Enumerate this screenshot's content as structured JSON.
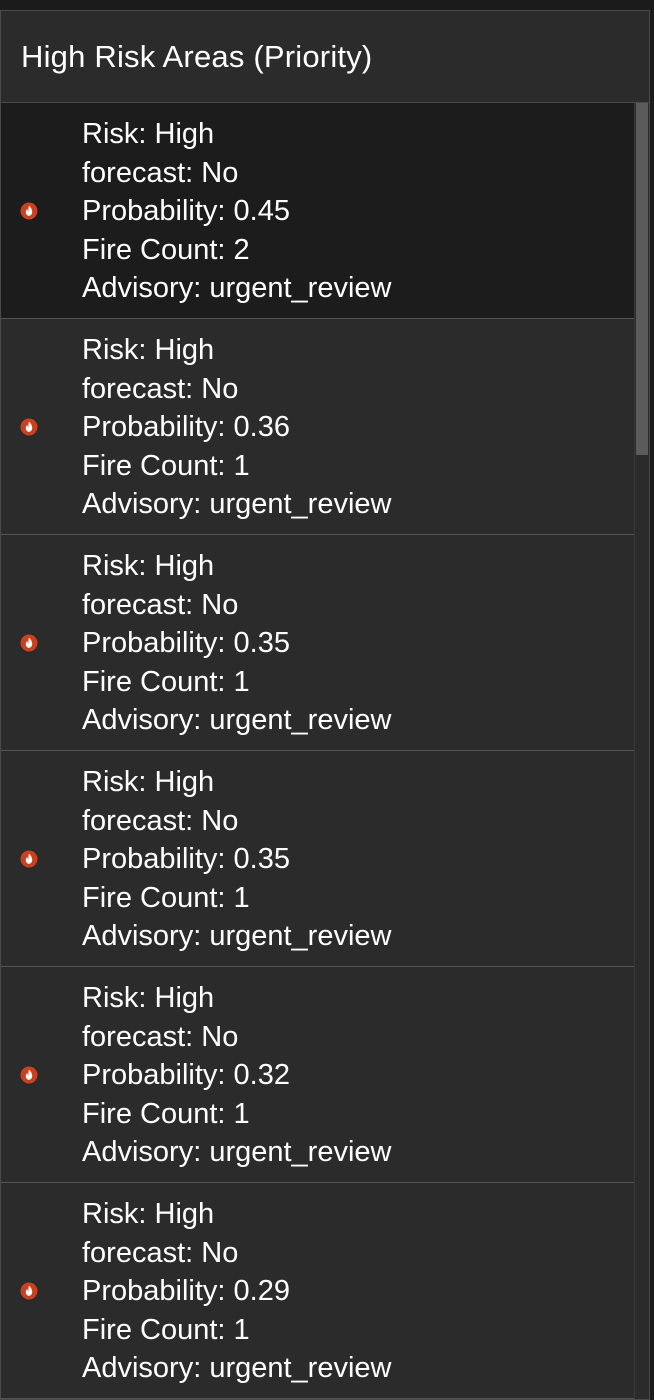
{
  "panel": {
    "title": "High Risk Areas (Priority)"
  },
  "icon": "fire-icon",
  "colors": {
    "icon_fill": "#c8421f",
    "icon_flame": "#ffffff"
  },
  "items": [
    {
      "risk": "Risk: High",
      "forecast": "forecast: No",
      "probability": "Probability: 0.45",
      "fire_count": "Fire Count: 2",
      "advisory": "Advisory: urgent_review"
    },
    {
      "risk": "Risk: High",
      "forecast": "forecast: No",
      "probability": "Probability: 0.36",
      "fire_count": "Fire Count: 1",
      "advisory": "Advisory: urgent_review"
    },
    {
      "risk": "Risk: High",
      "forecast": "forecast: No",
      "probability": "Probability: 0.35",
      "fire_count": "Fire Count: 1",
      "advisory": "Advisory: urgent_review"
    },
    {
      "risk": "Risk: High",
      "forecast": "forecast: No",
      "probability": "Probability: 0.35",
      "fire_count": "Fire Count: 1",
      "advisory": "Advisory: urgent_review"
    },
    {
      "risk": "Risk: High",
      "forecast": "forecast: No",
      "probability": "Probability: 0.32",
      "fire_count": "Fire Count: 1",
      "advisory": "Advisory: urgent_review"
    },
    {
      "risk": "Risk: High",
      "forecast": "forecast: No",
      "probability": "Probability: 0.29",
      "fire_count": "Fire Count: 1",
      "advisory": "Advisory: urgent_review"
    }
  ]
}
